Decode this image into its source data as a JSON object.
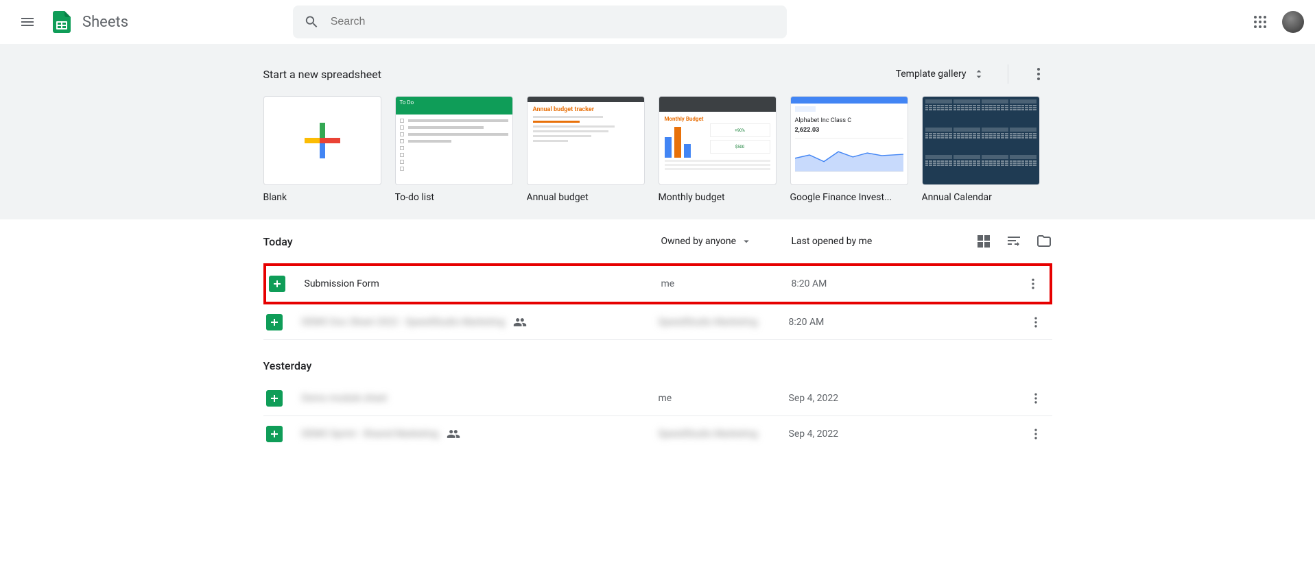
{
  "app": {
    "title": "Sheets"
  },
  "search": {
    "placeholder": "Search"
  },
  "templateBand": {
    "heading": "Start a new spreadsheet",
    "galleryLabel": "Template gallery",
    "templates": [
      {
        "label": "Blank"
      },
      {
        "label": "To-do list"
      },
      {
        "label": "Annual budget"
      },
      {
        "label": "Monthly budget"
      },
      {
        "label": "Google Finance Invest..."
      },
      {
        "label": "Annual Calendar"
      }
    ],
    "thumbs": {
      "todo_head": "To Do",
      "ab_title": "Annual budget tracker",
      "mb_title": "Monthly Budget",
      "mb_pct": "+90%",
      "mb_amt": "$500",
      "fin_title": "Alphabet Inc Class C",
      "fin_price": "2,622.03"
    }
  },
  "list": {
    "sections": [
      "Today",
      "Yesterday"
    ],
    "ownedByLabel": "Owned by anyone",
    "lastOpenedLabel": "Last opened by me",
    "files": [
      {
        "name": "Submission Form",
        "owner": "me",
        "date": "8:20 AM",
        "shared": false,
        "blurred": false
      },
      {
        "name": "DEMO Doc Sheet 2022 - SpeedStudio Marketing",
        "owner": "SpeedStudio Marketing",
        "date": "8:20 AM",
        "shared": true,
        "blurred": true
      },
      {
        "name": "Demo module sheet",
        "owner": "me",
        "date": "Sep 4, 2022",
        "shared": false,
        "blurred": true
      },
      {
        "name": "DEMO Sprint - Shared Marketing",
        "owner": "SpeedStudio Marketing",
        "date": "Sep 4, 2022",
        "shared": true,
        "blurred": true
      }
    ]
  }
}
